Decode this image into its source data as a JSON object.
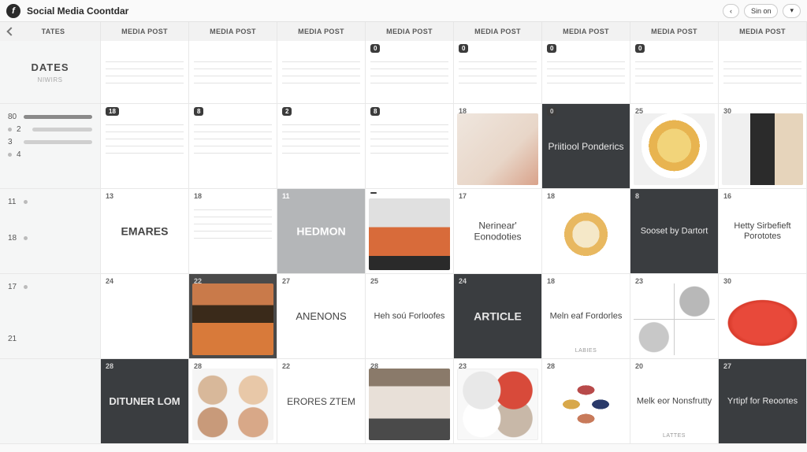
{
  "header": {
    "logo_glyph": "f",
    "title": "Social Media Coontdar",
    "back": "‹",
    "sign": "Sin on",
    "more": "▾"
  },
  "columns": [
    "TATES",
    "MEDIA POST",
    "MEDIA POST",
    "MEDIA POST",
    "MEDIA POST",
    "MEDIA POST",
    "MEDIA POST",
    "MEDIA POST",
    "MEDIA POST"
  ],
  "sidebar": {
    "heading": "DATES",
    "sub": "NIWIRS",
    "block1": [
      "80",
      "2",
      "3",
      "4"
    ],
    "block2": [
      "11",
      "18"
    ],
    "block3": [
      "17",
      "21"
    ]
  },
  "row0_badges": [
    "0",
    "0",
    "0",
    "0"
  ],
  "row1": {
    "nums": [
      "18",
      "8",
      "2",
      "8",
      "18",
      "0",
      "25",
      "30"
    ],
    "card5_title": "Priitiool Ponderics"
  },
  "row2": {
    "nums": [
      "13",
      "18",
      "11",
      "",
      "17",
      "18",
      "8",
      "16"
    ],
    "c0": "EMARES",
    "c2": "HEDMON",
    "c4": "Nerinear' Eonodoties",
    "c6": "Sooset by Dartort",
    "c7": "Hetty Sirbefieft Porototes"
  },
  "row3": {
    "nums": [
      "24",
      "22",
      "27",
      "25",
      "24",
      "18",
      "23",
      "30"
    ],
    "c2": "ANENONS",
    "c3_title": "Heh soú Forloofes",
    "c4": "ARTICLE",
    "c5_title": "Meln eaf Fordorles",
    "c5_sub": "LABIES"
  },
  "row4": {
    "nums": [
      "28",
      "28",
      "22",
      "28",
      "23",
      "28",
      "20",
      "27"
    ],
    "c0_title": "DITUNER LOM",
    "c2": "ERORES ZTEM",
    "c6_title": "Melk eor Nonsfrutty",
    "c6_sub": "LATTES",
    "c7_title": "Yrtipf for Reoortes"
  }
}
